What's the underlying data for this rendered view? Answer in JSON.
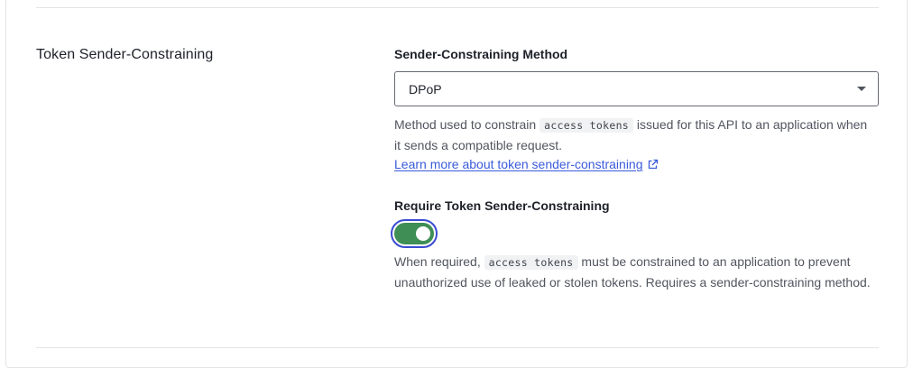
{
  "section": {
    "title": "Token Sender-Constraining"
  },
  "method": {
    "label": "Sender-Constraining Method",
    "selected_value": "DPoP",
    "help_before": "Method used to constrain ",
    "help_code": "access tokens",
    "help_after": " issued for this API to an application when it sends a compatible request.",
    "link_text": "Learn more about token sender-constraining",
    "link_icon": "external-link-icon"
  },
  "require": {
    "label": "Require Token Sender-Constraining",
    "toggle_state": "on",
    "help_before": "When required, ",
    "help_code": "access tokens",
    "help_after": " must be constrained to an application to prevent unauthorized use of leaked or stolen tokens. Requires a sender-constraining method."
  },
  "colors": {
    "toggle_on": "#3e8e56",
    "focus_ring": "#3a4bd1",
    "link": "#3b5bdb"
  }
}
